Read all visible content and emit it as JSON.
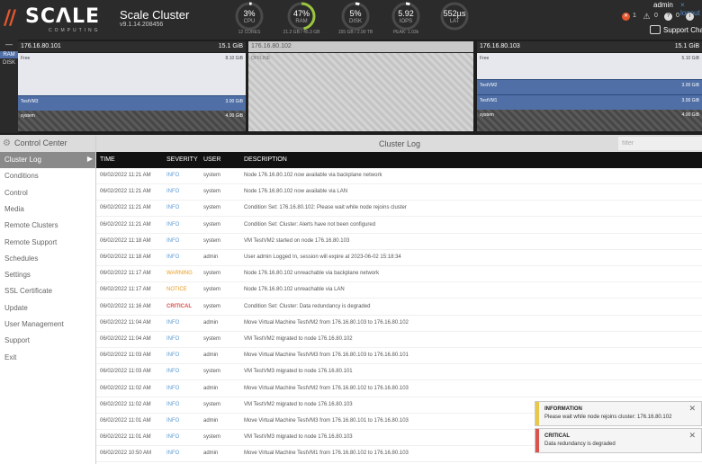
{
  "header": {
    "logo_word": "SCΛLE",
    "logo_sub": "COMPUTING",
    "cluster_name": "Scale Cluster",
    "version": "v9.1.14.208456",
    "gauges": [
      {
        "value": "3%",
        "label": "CPU",
        "sub": "12 CORES",
        "level": 0.03,
        "color": "#ffffff"
      },
      {
        "value": "47%",
        "label": "RAM",
        "sub": "21.2 GB / 45.3 GB",
        "level": 0.47,
        "color": "#9bc53d"
      },
      {
        "value": "5%",
        "label": "DISK",
        "sub": "155 GB / 2.90 TB",
        "level": 0.05,
        "color": "#ffffff"
      },
      {
        "value": "5.92",
        "label": "IOPS",
        "sub": "PEAK: 1.03k",
        "level": 0.05,
        "color": "#ffffff"
      },
      {
        "value": "552µs",
        "label": "LAT",
        "sub": "",
        "level": 0.0,
        "color": "#ffffff"
      }
    ],
    "user": "admin",
    "logout": "× logout",
    "alerts": {
      "critical": "1",
      "warnings": "0",
      "info": "0"
    },
    "support_chat": "Support Chat"
  },
  "nodes": {
    "toggle": {
      "dash": "—",
      "ram": "RAM",
      "disk": "DISK"
    },
    "list": [
      {
        "ip": "176.16.80.101",
        "total": "15.1 GiB",
        "offline": false,
        "segments": [
          {
            "type": "free",
            "name": "Free",
            "size": "8.10 GiB",
            "share": 0.536
          },
          {
            "type": "vm",
            "name": "TestVM3",
            "size": "3.00 GiB",
            "share": 0.199
          },
          {
            "type": "sys",
            "name": "system",
            "size": "4.00 GiB",
            "share": 0.265
          }
        ]
      },
      {
        "ip": "176.16.80.102",
        "total": "",
        "offline": true,
        "offline_label": "OFFLINE",
        "segments": []
      },
      {
        "ip": "176.16.80.103",
        "total": "15.1 GiB",
        "offline": false,
        "segments": [
          {
            "type": "free",
            "name": "Free",
            "size": "5.10 GiB",
            "share": 0.338
          },
          {
            "type": "vm",
            "name": "TestVM2",
            "size": "3.00 GiB",
            "share": 0.199
          },
          {
            "type": "vm",
            "name": "TestVM1",
            "size": "3.00 GiB",
            "share": 0.199
          },
          {
            "type": "sys",
            "name": "system",
            "size": "4.00 GiB",
            "share": 0.264
          }
        ]
      }
    ]
  },
  "sidebar": {
    "title": "Control Center",
    "items": [
      {
        "label": "Cluster Log",
        "active": true
      },
      {
        "label": "Conditions",
        "active": false
      },
      {
        "label": "Control",
        "active": false
      },
      {
        "label": "Media",
        "active": false
      },
      {
        "label": "Remote Clusters",
        "active": false
      },
      {
        "label": "Remote Support",
        "active": false
      },
      {
        "label": "Schedules",
        "active": false
      },
      {
        "label": "Settings",
        "active": false
      },
      {
        "label": "SSL Certificate",
        "active": false
      },
      {
        "label": "Update",
        "active": false
      },
      {
        "label": "User Management",
        "active": false
      },
      {
        "label": "Support",
        "active": false
      },
      {
        "label": "Exit",
        "active": false
      }
    ]
  },
  "log": {
    "title": "Cluster Log",
    "filter_placeholder": "filter",
    "columns": {
      "time": "TIME",
      "severity": "SEVERITY",
      "user": "USER",
      "description": "DESCRIPTION"
    },
    "rows": [
      {
        "time": "06/02/2022 11:21 AM",
        "severity": "INFO",
        "user": "system",
        "desc": "Node 176.16.80.102 now available via backplane network"
      },
      {
        "time": "06/02/2022 11:21 AM",
        "severity": "INFO",
        "user": "system",
        "desc": "Node 176.16.80.102 now available via LAN"
      },
      {
        "time": "06/02/2022 11:21 AM",
        "severity": "INFO",
        "user": "system",
        "desc": "Condition Set: 176.16.80.102: Please wait while node rejoins cluster"
      },
      {
        "time": "06/02/2022 11:21 AM",
        "severity": "INFO",
        "user": "system",
        "desc": "Condition Set: Cluster: Alerts have not been configured"
      },
      {
        "time": "06/02/2022 11:18 AM",
        "severity": "INFO",
        "user": "system",
        "desc": "VM TestVM2 started on node 176.16.80.103"
      },
      {
        "time": "06/02/2022 11:18 AM",
        "severity": "INFO",
        "user": "admin",
        "desc": "User admin Logged In, session will expire at 2023-06-02 15:18:34"
      },
      {
        "time": "06/02/2022 11:17 AM",
        "severity": "WARNING",
        "user": "system",
        "desc": "Node 176.16.80.102 unreachable via backplane network"
      },
      {
        "time": "06/02/2022 11:17 AM",
        "severity": "NOTICE",
        "user": "system",
        "desc": "Node 176.16.80.102 unreachable via LAN"
      },
      {
        "time": "06/02/2022 11:16 AM",
        "severity": "CRITICAL",
        "user": "system",
        "desc": "Condition Set: Cluster: Data redundancy is degraded"
      },
      {
        "time": "06/02/2022 11:04 AM",
        "severity": "INFO",
        "user": "admin",
        "desc": "Move Virtual Machine TestVM2 from 176.16.80.103 to 176.16.80.102"
      },
      {
        "time": "06/02/2022 11:04 AM",
        "severity": "INFO",
        "user": "system",
        "desc": "VM TestVM2 migrated to node 176.16.80.102"
      },
      {
        "time": "06/02/2022 11:03 AM",
        "severity": "INFO",
        "user": "admin",
        "desc": "Move Virtual Machine TestVM3 from 176.16.80.103 to 176.16.80.101"
      },
      {
        "time": "06/02/2022 11:03 AM",
        "severity": "INFO",
        "user": "system",
        "desc": "VM TestVM3 migrated to node 176.16.80.101"
      },
      {
        "time": "06/02/2022 11:02 AM",
        "severity": "INFO",
        "user": "admin",
        "desc": "Move Virtual Machine TestVM2 from 176.16.80.102 to 176.16.80.103"
      },
      {
        "time": "06/02/2022 11:02 AM",
        "severity": "INFO",
        "user": "system",
        "desc": "VM TestVM2 migrated to node 176.16.80.103"
      },
      {
        "time": "06/02/2022 11:01 AM",
        "severity": "INFO",
        "user": "admin",
        "desc": "Move Virtual Machine TestVM3 from 176.16.80.101 to 176.16.80.103"
      },
      {
        "time": "06/02/2022 11:01 AM",
        "severity": "INFO",
        "user": "system",
        "desc": "VM TestVM3 migrated to node 176.16.80.103"
      },
      {
        "time": "06/02/2022 10:50 AM",
        "severity": "INFO",
        "user": "admin",
        "desc": "Move Virtual Machine TestVM1 from 176.16.80.102 to 176.16.80.103"
      }
    ]
  },
  "toasts": [
    {
      "title": "INFORMATION",
      "message": "Please wait while node rejoins cluster: 176.16.80.102",
      "color": "#e8c84a"
    },
    {
      "title": "CRITICAL",
      "message": "Data redundancy is degraded",
      "color": "#d9534f"
    }
  ],
  "colors": {
    "accent": "#e4572e",
    "vm_blue": "#4f6fa6",
    "info_blue": "#5b9bd5",
    "warning": "#e69b22",
    "critical": "#d9534f"
  }
}
